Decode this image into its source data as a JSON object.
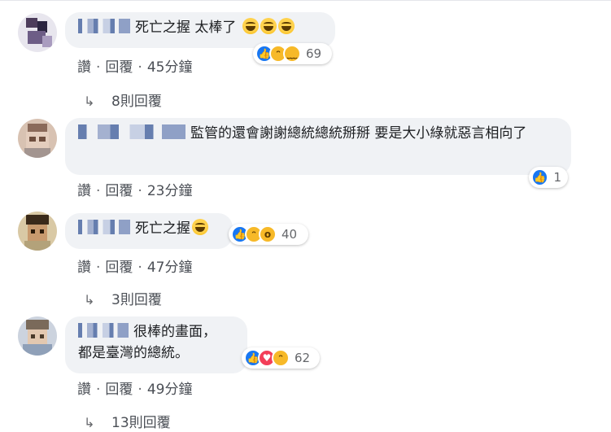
{
  "actions": {
    "like": "讚",
    "reply": "回覆",
    "separator": "·"
  },
  "comments": [
    {
      "text": "死亡之握 太棒了",
      "reaction_count": "69",
      "time": "45分鐘",
      "replies_label": "8則回覆"
    },
    {
      "text": "監管的還會謝謝總統總統掰掰 要是大小綠就惡言相向了",
      "reaction_count": "1",
      "time": "23分鐘"
    },
    {
      "text": "死亡之握",
      "reaction_count": "40",
      "time": "47分鐘",
      "replies_label": "3則回覆"
    },
    {
      "text_line1": "很棒的畫面，",
      "text_line2": "都是臺灣的總統。",
      "reaction_count": "62",
      "time": "49分鐘",
      "replies_label": "13則回覆"
    }
  ],
  "icons": {
    "reply_arrow": "reply-arrow-icon",
    "like": "like-reaction-icon",
    "haha": "haha-reaction-icon",
    "sad": "sad-reaction-icon",
    "wow": "wow-reaction-icon",
    "love": "love-reaction-icon"
  },
  "colors": {
    "bubble": "#f0f2f5",
    "like": "#1877f2",
    "love": "#f33e58",
    "emoji": "#f7b928",
    "meta": "#4b4f56"
  }
}
